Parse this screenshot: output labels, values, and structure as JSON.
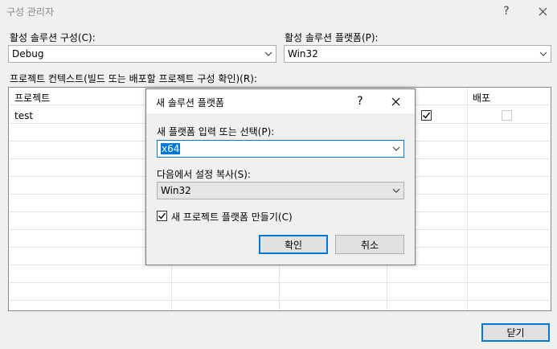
{
  "window": {
    "title": "구성 관리자",
    "help": "?",
    "close": "✕"
  },
  "active_config": {
    "label": "활성 솔루션 구성(C):",
    "value": "Debug"
  },
  "active_platform": {
    "label": "활성 솔루션 플랫폼(P):",
    "value": "Win32"
  },
  "project_contexts": {
    "label": "프로젝트 컨텍스트(빌드 또는 배포할 프로젝트 구성 확인)(R):",
    "columns": [
      "프로젝트",
      "배포"
    ],
    "rows": [
      {
        "project": "test",
        "build_checked": true,
        "deploy_checked": false
      }
    ]
  },
  "close_button": "닫기",
  "dialog": {
    "title": "새 솔루션 플랫폼",
    "help": "?",
    "close": "✕",
    "platform_label": "새 플랫폼 입력 또는 선택(P):",
    "platform_value": "x64",
    "copy_label": "다음에서 설정 복사(S):",
    "copy_value": "Win32",
    "create_checkbox_label": "새 프로젝트 플랫폼 만들기(C)",
    "create_checked": true,
    "ok": "확인",
    "cancel": "취소"
  }
}
